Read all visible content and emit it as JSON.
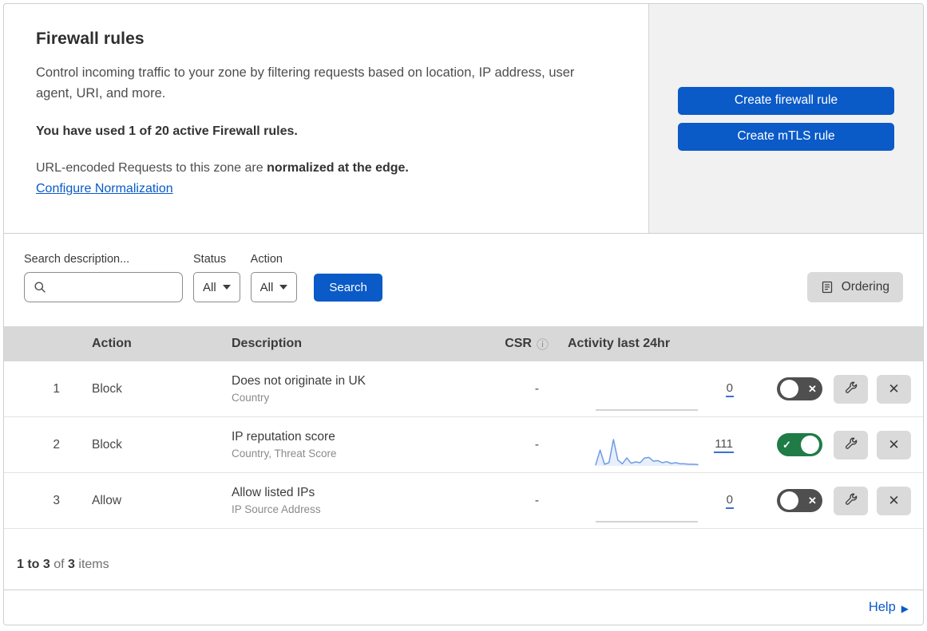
{
  "intro": {
    "title": "Firewall rules",
    "description": "Control incoming traffic to your zone by filtering requests based on location, IP address, user agent, URI, and more.",
    "usage": "You have used 1 of 20 active Firewall rules.",
    "normalization_text": "URL-encoded Requests to this zone are ",
    "normalization_bold": "normalized at the edge.",
    "normalization_link": "Configure Normalization"
  },
  "actions": {
    "create_firewall_rule": "Create firewall rule",
    "create_mtls_rule": "Create mTLS rule"
  },
  "filters": {
    "search_label": "Search description...",
    "search_value": "",
    "status_label": "Status",
    "status_value": "All",
    "action_label": "Action",
    "action_value": "All",
    "search_button": "Search",
    "ordering_button": "Ordering"
  },
  "table": {
    "columns": {
      "action": "Action",
      "description": "Description",
      "csr": "CSR",
      "activity": "Activity last 24hr"
    },
    "rows": [
      {
        "priority": "1",
        "action": "Block",
        "description": "Does not originate in UK",
        "fields": "Country",
        "csr": "-",
        "count": "0",
        "status": "off"
      },
      {
        "priority": "2",
        "action": "Block",
        "description": "IP reputation score",
        "fields": "Country, Threat Score",
        "csr": "-",
        "count": "111",
        "status": "on"
      },
      {
        "priority": "3",
        "action": "Allow",
        "description": "Allow listed IPs",
        "fields": "IP Source Address",
        "csr": "-",
        "count": "0",
        "status": "off"
      }
    ]
  },
  "chart_data": {
    "type": "line",
    "title": "Activity last 24hr",
    "x_range_hours": 24,
    "legend": "none",
    "series": [
      {
        "name": "Does not originate in UK",
        "total": 0,
        "values": [
          0,
          0,
          0,
          0,
          0,
          0,
          0,
          0,
          0,
          0,
          0,
          0,
          0,
          0,
          0,
          0,
          0,
          0,
          0,
          0,
          0,
          0,
          0,
          0
        ]
      },
      {
        "name": "IP reputation score",
        "total": 111,
        "values": [
          4,
          60,
          6,
          12,
          100,
          22,
          8,
          30,
          10,
          15,
          12,
          30,
          32,
          18,
          20,
          12,
          16,
          9,
          12,
          8,
          8,
          6,
          6,
          5
        ]
      },
      {
        "name": "Allow listed IPs",
        "total": 0,
        "values": [
          0,
          0,
          0,
          0,
          0,
          0,
          0,
          0,
          0,
          0,
          0,
          0,
          0,
          0,
          0,
          0,
          0,
          0,
          0,
          0,
          0,
          0,
          0,
          0
        ]
      }
    ]
  },
  "footer": {
    "range": "1 to 3",
    "of": " of ",
    "total": "3",
    "items": " items",
    "help": "Help"
  },
  "icons": {
    "check": "✓",
    "cross": "✕",
    "close": "✕",
    "info": "ⓘ",
    "help_arrow": "▶"
  },
  "colors": {
    "primary_blue": "#0a5ac8",
    "link_blue": "#0a5ac8",
    "toggle_on_green": "#1f7c46",
    "toggle_off_gray": "#4f4f4f",
    "table_header_gray": "#d8d8d8",
    "side_panel_gray": "#f1f1f1",
    "sparkline_blue": "#6f9be6"
  }
}
